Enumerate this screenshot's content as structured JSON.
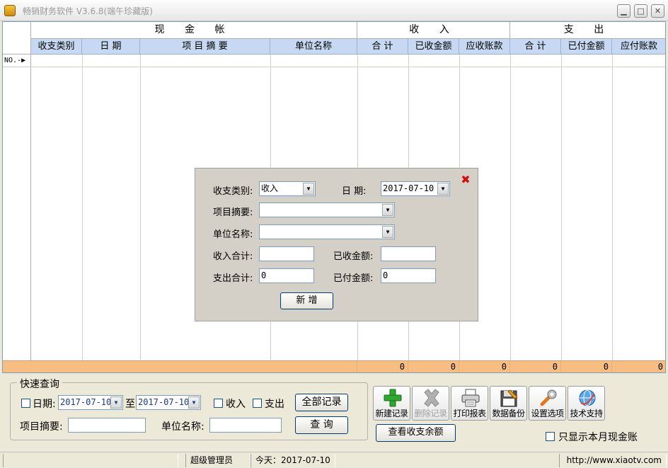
{
  "window": {
    "title": "畅销财务软件 V3.6.8(端午珍藏版)",
    "min_glyph": "▁",
    "max_glyph": "□",
    "close_glyph": "✕"
  },
  "grid": {
    "group_headers": [
      "现 金 帐",
      "收 入",
      "支 出"
    ],
    "columns": [
      "收支类别",
      "日 期",
      "项 目 摘 要",
      "单位名称",
      "合 计",
      "已收金额",
      "应收账款",
      "合 计",
      "已付金额",
      "应付账款"
    ],
    "row_marker": "NO.-▶",
    "totals": [
      "0",
      "0",
      "0",
      "0",
      "0",
      "0"
    ]
  },
  "dialog": {
    "type_label": "收支类别:",
    "type_value": "收入",
    "date_label": "日  期:",
    "date_value": "2017-07-10",
    "summary_label": "项目摘要:",
    "summary_value": "",
    "unit_label": "单位名称:",
    "unit_value": "",
    "income_total_label": "收入合计:",
    "income_total_value": "",
    "received_label": "已收金额:",
    "received_value": "",
    "expense_total_label": "支出合计:",
    "expense_total_value": "0",
    "paid_label": "已付金额:",
    "paid_value": "0",
    "add_button": "新 增",
    "close_glyph": "✖",
    "dropdown_glyph": "▼"
  },
  "quick_query": {
    "title": "快速查询",
    "date_label": "日期:",
    "date_from": "2017-07-10",
    "to_label": "至",
    "date_to": "2017-07-10",
    "income_label": "收入",
    "expense_label": "支出",
    "all_records_button": "全部记录",
    "summary_label": "项目摘要:",
    "summary_value": "",
    "unit_label": "单位名称:",
    "unit_value": "",
    "query_button": "查 询"
  },
  "toolbar": {
    "new_record": "新建记录",
    "delete_record": "删除记录",
    "print_report": "打印报表",
    "backup": "数据备份",
    "settings": "设置选项",
    "support": "技术支持",
    "balance_button": "查看收支余额",
    "month_only_label": "只显示本月现金账"
  },
  "status": {
    "user": "超级管理员",
    "today": "今天：2017-07-10",
    "website": "http://www.xiaotv.com"
  },
  "colors": {
    "header_blue": "#c7d9f2",
    "totals_orange": "#f8bd82",
    "close_red": "#d01010",
    "add_green": "#2fa82f"
  }
}
